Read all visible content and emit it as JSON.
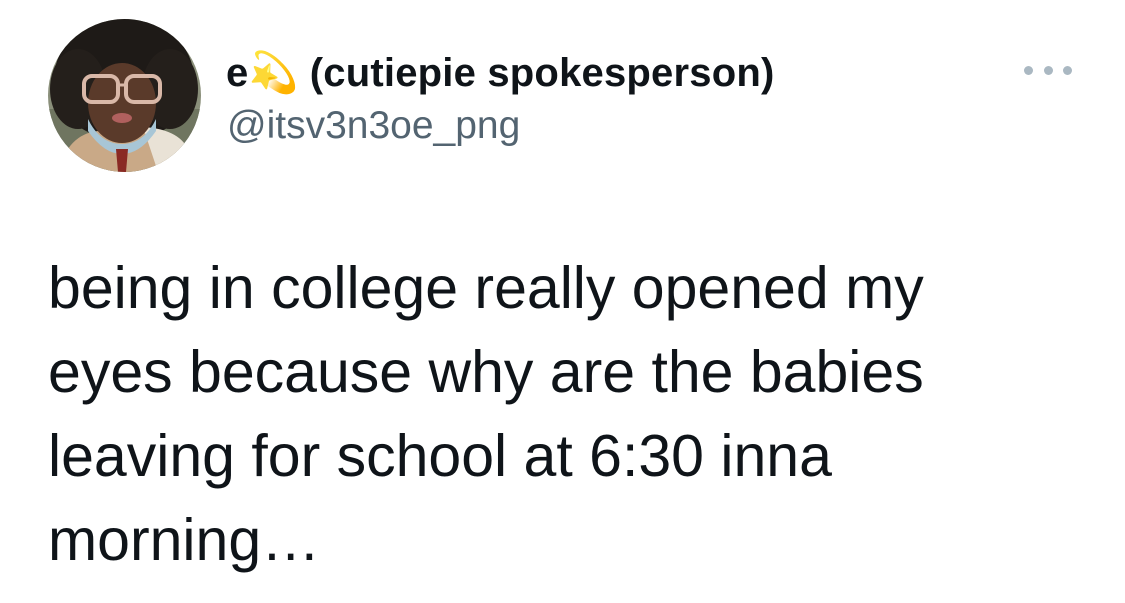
{
  "author": {
    "display_name": "e💫 (cutiepie spokesperson)",
    "handle": "@itsv3n3oe_png",
    "avatar_icon": "profile-photo"
  },
  "menu": {
    "more_icon": "more-horizontal-icon"
  },
  "tweet": {
    "text": "being in college really opened my eyes because why are the babies leaving for school at 6:30 inna morning…"
  },
  "colors": {
    "text": "#0f1419",
    "secondary": "#536471",
    "more_dots": "#aab8c2"
  }
}
